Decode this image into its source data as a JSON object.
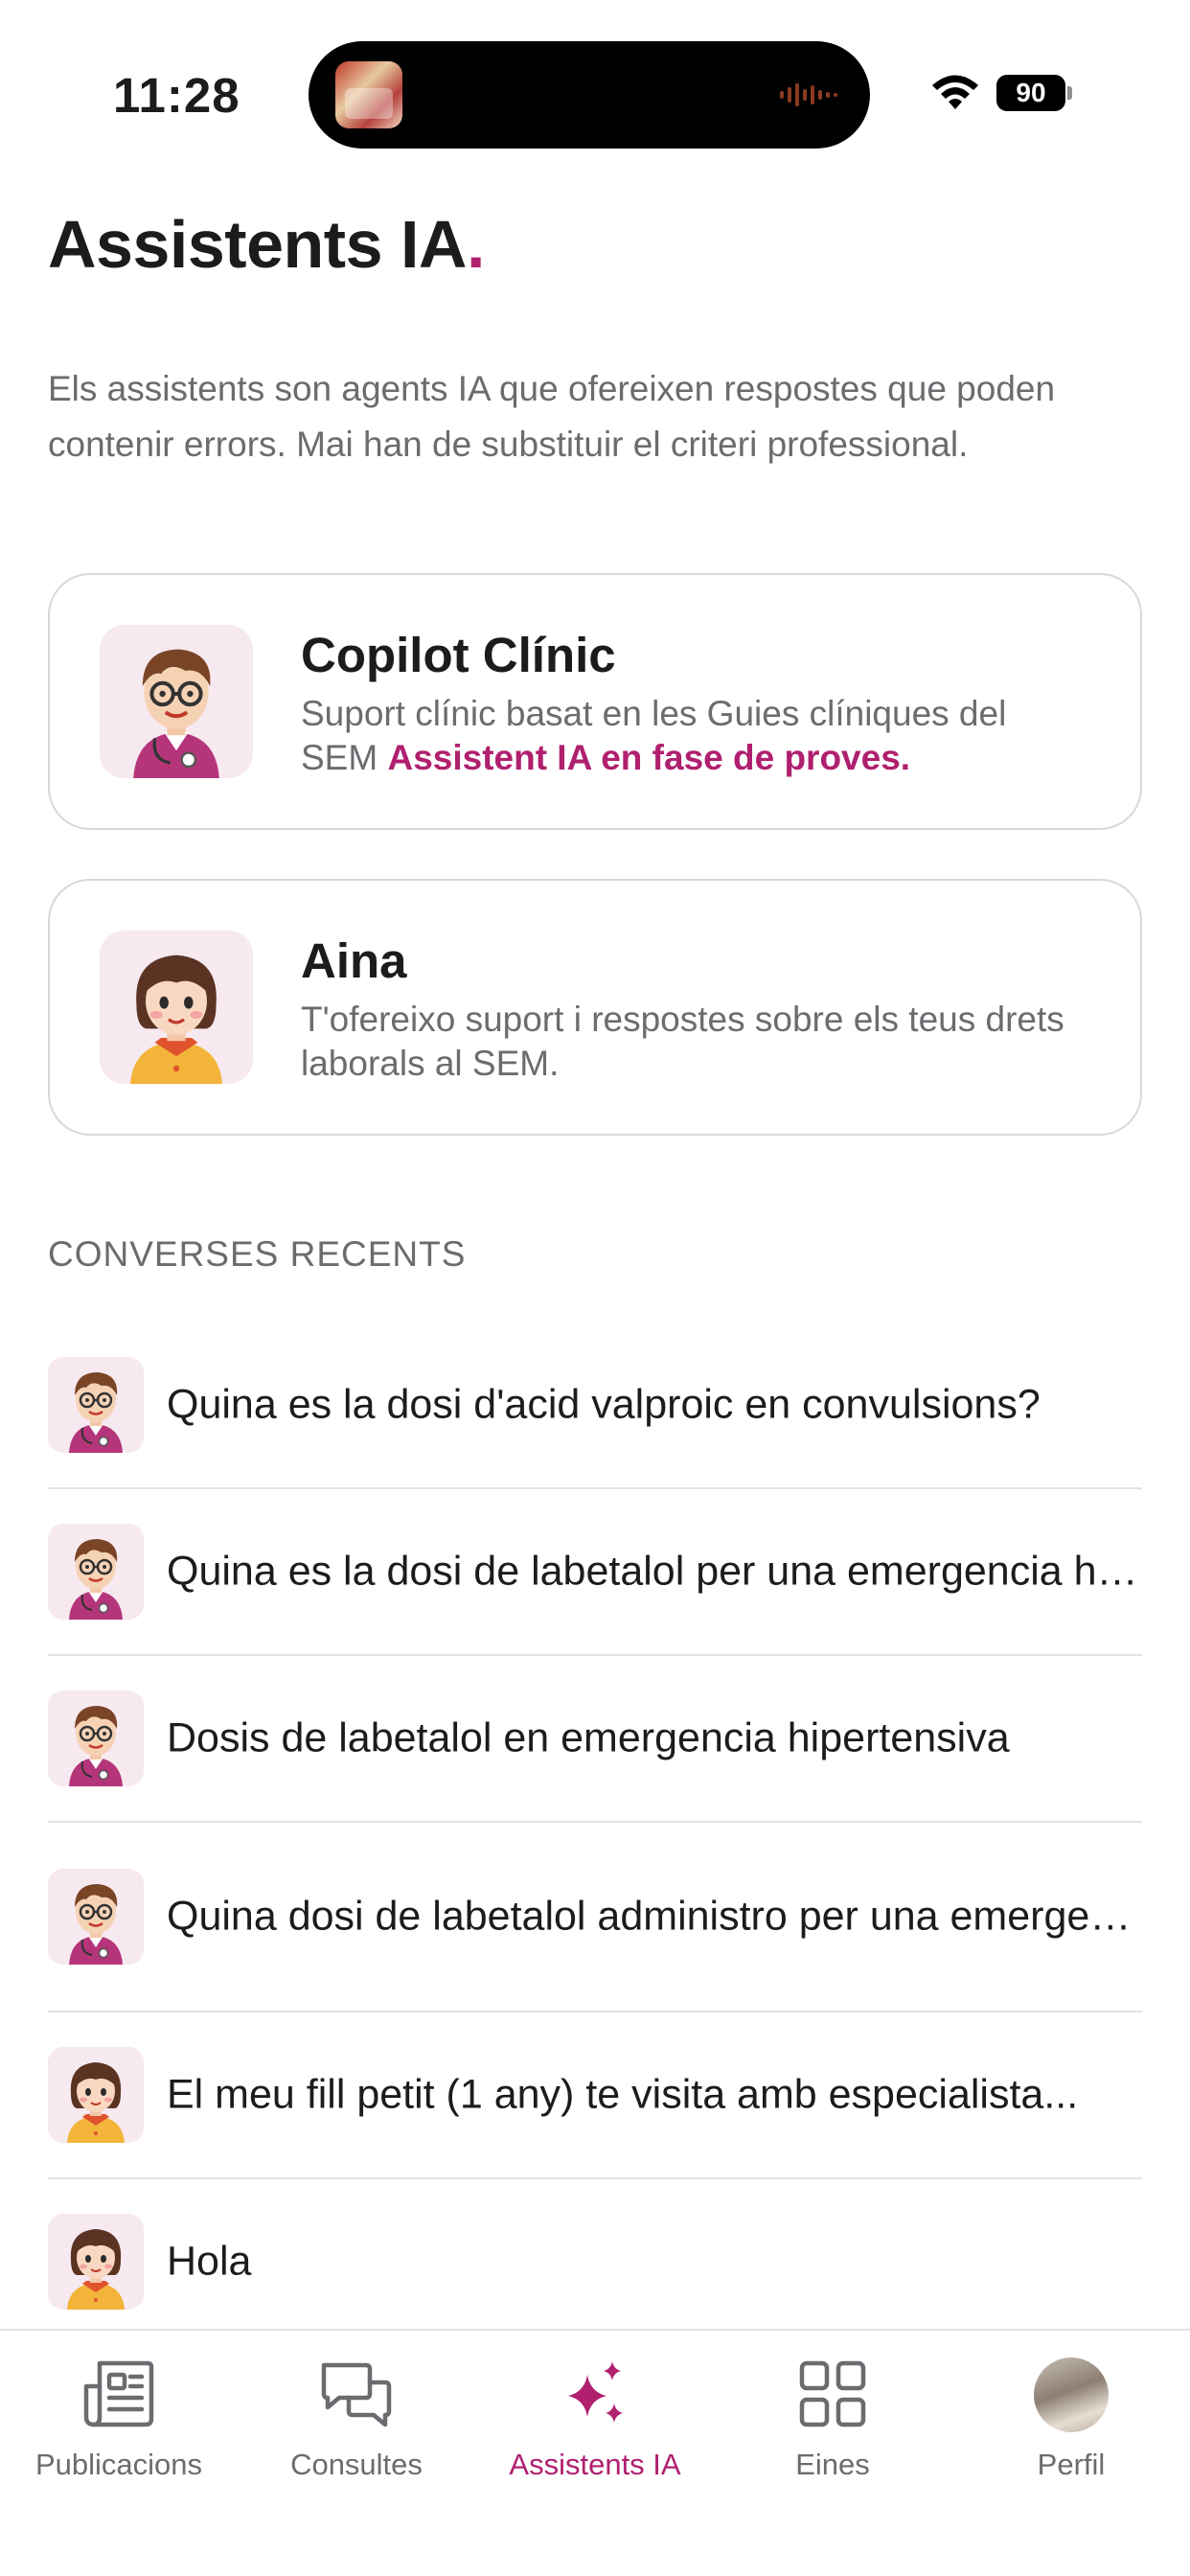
{
  "status_bar": {
    "time": "11:28",
    "battery": "90"
  },
  "header": {
    "title": "Assistents IA",
    "title_dot": "."
  },
  "intro_text": "Els assistents son agents IA que ofereixen respostes que poden contenir errors. Mai han de substituir el criteri professional.",
  "assistants": [
    {
      "name": "Copilot Clínic",
      "description": "Suport clínic basat en les Guies clíniques del SEM",
      "badge": "Assistent IA en fase de proves.",
      "avatar": "doctor-avatar-icon"
    },
    {
      "name": "Aina",
      "description": "T'ofereixo suport i respostes sobre els teus drets laborals al SEM.",
      "avatar": "girl-avatar-icon"
    }
  ],
  "recent_section_title": "CONVERSES RECENTS",
  "recent_conversations": [
    {
      "text": "Quina es la dosi d'acid valproic en convulsions?",
      "avatar": "doctor-avatar-icon"
    },
    {
      "text": "Quina es la dosi de labetalol per una emergencia hipertensiva?",
      "avatar": "doctor-avatar-icon"
    },
    {
      "text": "Dosis de labetalol en emergencia hipertensiva",
      "avatar": "doctor-avatar-icon"
    },
    {
      "text": "Quina dosi de labetalol administro per una emergencia hipertensiva?",
      "avatar": "doctor-avatar-icon"
    },
    {
      "text": "El meu fill petit (1 any) te visita amb especialista...",
      "avatar": "girl-avatar-icon"
    },
    {
      "text": "Hola",
      "avatar": "girl-avatar-icon"
    }
  ],
  "tab_bar": {
    "active": "Assistents IA",
    "tabs": [
      {
        "label": "Publicacions",
        "icon": "newspaper-icon"
      },
      {
        "label": "Consultes",
        "icon": "chat-bubbles-icon"
      },
      {
        "label": "Assistents IA",
        "icon": "sparkles-icon"
      },
      {
        "label": "Eines",
        "icon": "grid-icon"
      },
      {
        "label": "Perfil",
        "icon": "profile-avatar"
      }
    ]
  },
  "colors": {
    "accent": "#b0206f",
    "text": "#1c1c1e",
    "secondary_text": "#6b6b70",
    "border": "#d8d8dc",
    "avatar_bg": "#f7e9f0"
  }
}
